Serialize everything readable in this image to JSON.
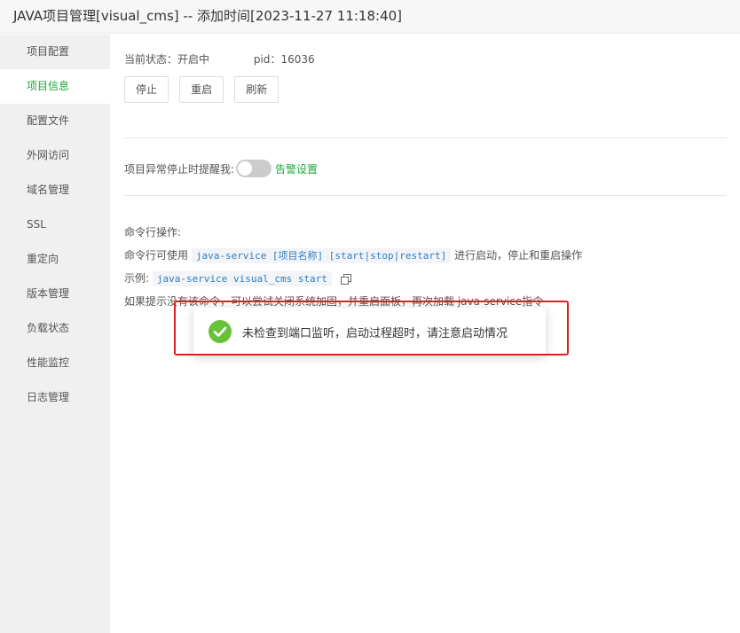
{
  "window": {
    "title": "JAVA项目管理[visual_cms] -- 添加时间[2023-11-27 11:18:40]"
  },
  "sidebar": {
    "items": [
      {
        "label": "项目配置",
        "active": false
      },
      {
        "label": "项目信息",
        "active": true
      },
      {
        "label": "配置文件",
        "active": false
      },
      {
        "label": "外网访问",
        "active": false
      },
      {
        "label": "域名管理",
        "active": false
      },
      {
        "label": "SSL",
        "active": false
      },
      {
        "label": "重定向",
        "active": false
      },
      {
        "label": "版本管理",
        "active": false
      },
      {
        "label": "负载状态",
        "active": false
      },
      {
        "label": "性能监控",
        "active": false
      },
      {
        "label": "日志管理",
        "active": false
      }
    ]
  },
  "status": {
    "state_label": "当前状态：",
    "state_value": "开启中",
    "pid_label": "pid：",
    "pid_value": "16036"
  },
  "buttons": {
    "stop": "停止",
    "restart": "重启",
    "refresh": "刷新"
  },
  "alarm": {
    "label": "项目异常停止时提醒我:",
    "toggle_on": false,
    "link": "告警设置"
  },
  "commands": {
    "heading": "命令行操作:",
    "usage_prefix": "命令行可使用",
    "usage_code": "java-service [项目名称] [start|stop|restart]",
    "usage_suffix": "进行启动，停止和重启操作",
    "example_label": "示例:",
    "example_code": "java-service visual_cms start",
    "hint": "如果提示没有该命令，可以尝试关闭系统加固，并重启面板，再次加载 java-service指令"
  },
  "toast": {
    "message": "未检查到端口监听，启动过程超时，请注意启动情况",
    "icon": "check-circle-icon",
    "color": "#67c23a"
  },
  "colors": {
    "accent": "#20a53a",
    "highlight": "#e02020",
    "code": "#2d7dc2"
  }
}
